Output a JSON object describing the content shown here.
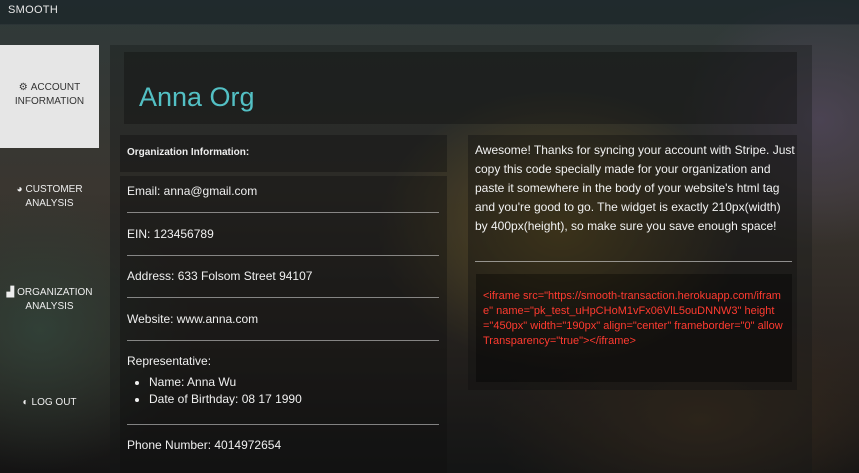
{
  "app": {
    "brand": "SMOOTH"
  },
  "sidebar": {
    "items": [
      {
        "icon": "gear-icon",
        "glyph": "⚙",
        "label": "ACCOUNT INFORMATION",
        "active": true
      },
      {
        "icon": "pie-chart-icon",
        "glyph": "◕",
        "label": "CUSTOMER ANALYSIS",
        "active": false
      },
      {
        "icon": "bar-chart-icon",
        "glyph": "▟",
        "label": "ORGANIZATION ANALYSIS",
        "active": false
      },
      {
        "icon": "logout-icon",
        "glyph": "◐",
        "label": "LOG OUT",
        "active": false
      }
    ]
  },
  "main": {
    "org_name": "Anna Org",
    "info_title": "Organization Information:",
    "email": "Email: anna@gmail.com",
    "ein": "EIN: 123456789",
    "address": "Address: 633 Folsom Street 94107",
    "website": "Website: www.anna.com",
    "representative_label": "Representative:",
    "rep_name": "Name: Anna Wu",
    "rep_dob": "Date of Birthday: 08 17 1990",
    "phone": "Phone Number: 4014972654"
  },
  "stripe": {
    "message": "Awesome! Thanks for syncing your account with Stripe. Just copy this code specially made for your organization and paste it somewhere in the body of your website's html tag and you're good to go. The widget is exactly 210px(width) by 400px(height), so make sure you save enough space!",
    "code": "<iframe src=\"https://smooth-transaction.herokuapp.com/iframe\" name=\"pk_test_uHpCHoM1vFx06VlL5ouDNNW3\" height=\"450px\" width=\"190px\" align=\"center\" frameborder=\"0\" allowTransparency=\"true\"></iframe>"
  },
  "colors": {
    "accent": "#53c0c4",
    "code": "#ff3b30",
    "active_nav_bg": "#e6e6e6"
  }
}
